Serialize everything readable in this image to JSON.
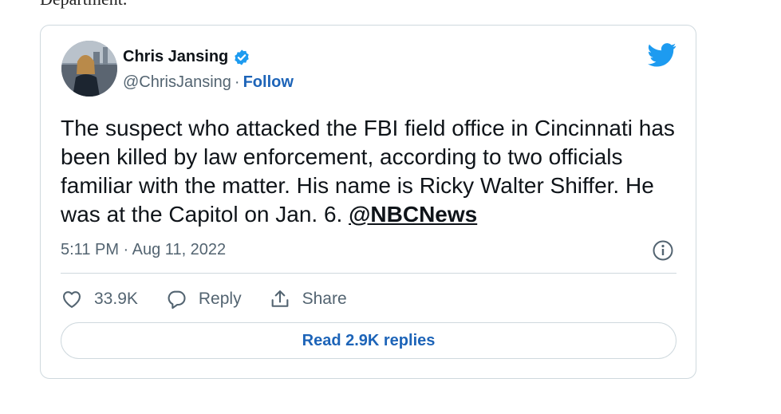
{
  "page": {
    "text_above_card": "Department."
  },
  "tweet": {
    "author_name": "Chris Jansing",
    "handle": "@ChrisJansing",
    "separator": "·",
    "follow_label": "Follow",
    "text": "The suspect who attacked the FBI field office in Cincinnati has been killed by law enforcement, according to two officials familiar with the matter. His name is Ricky Walter Shiffer. He was at the Capitol on Jan. 6.",
    "mention": "@NBCNews",
    "timestamp": "5:11 PM · Aug 11, 2022",
    "likes": "33.9K",
    "reply_label": "Reply",
    "share_label": "Share",
    "read_replies_label": "Read 2.9K replies"
  },
  "colors": {
    "link": "#1d64b8",
    "twitter_blue": "#1d9bf0",
    "muted": "#536471",
    "border": "#cfd9de"
  },
  "icons": [
    "verified-badge-icon",
    "twitter-bird-icon",
    "info-icon",
    "heart-icon",
    "reply-bubble-icon",
    "share-icon"
  ]
}
